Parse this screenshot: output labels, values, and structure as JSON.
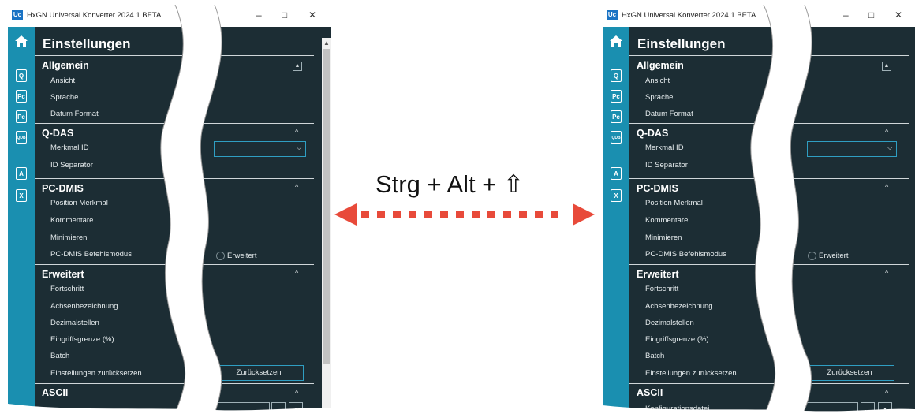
{
  "window": {
    "app_icon_text": "Uc",
    "title": "HxGN Universal Konverter 2024.1 BETA",
    "minimize_glyph": "–",
    "maximize_glyph": "□",
    "close_glyph": "✕"
  },
  "sidebar": {
    "items": [
      {
        "icon": "home-icon"
      },
      {
        "icon": "q-export-icon",
        "text": "Q"
      },
      {
        "icon": "pc-icon",
        "text": "Pc"
      },
      {
        "icon": "pc-export-icon",
        "text": "Pc"
      },
      {
        "icon": "qdb-icon",
        "text": "QDB"
      },
      {
        "icon": "pdf-export-icon",
        "text": "A"
      },
      {
        "icon": "excel-export-icon",
        "text": "X"
      }
    ]
  },
  "settings": {
    "page_title": "Einstellungen",
    "sections": {
      "allgemein": {
        "title": "Allgemein",
        "items": [
          "Ansicht",
          "Sprache",
          "Datum Format"
        ]
      },
      "qdas": {
        "title": "Q-DAS",
        "items": [
          "Merkmal ID",
          "ID Separator"
        ]
      },
      "pcdmis": {
        "title": "PC-DMIS",
        "items": [
          "Position Merkmal",
          "Kommentare",
          "Minimieren",
          "PC-DMIS Befehlsmodus"
        ],
        "radio_label": "Erweitert"
      },
      "erweitert": {
        "title": "Erweitert",
        "items": [
          "Fortschritt",
          "Achsenbezeichnung",
          "Dezimalstellen",
          "Eingriffsgrenze (%)",
          "Batch",
          "Einstellungen zurücksetzen"
        ],
        "reset_button": "Zurücksetzen"
      },
      "ascii": {
        "title": "ASCII",
        "items": [
          "Konfigurationsdatei"
        ],
        "browse_label": "..."
      }
    },
    "caret_up": "^"
  },
  "shortcut": {
    "text": "Strg + Alt +",
    "key_glyph": "⇧"
  },
  "colors": {
    "sidebar": "#1a8fb0",
    "main_bg": "#1c2d34",
    "accent": "#2f9ec2",
    "arrow": "#e84a3a"
  }
}
